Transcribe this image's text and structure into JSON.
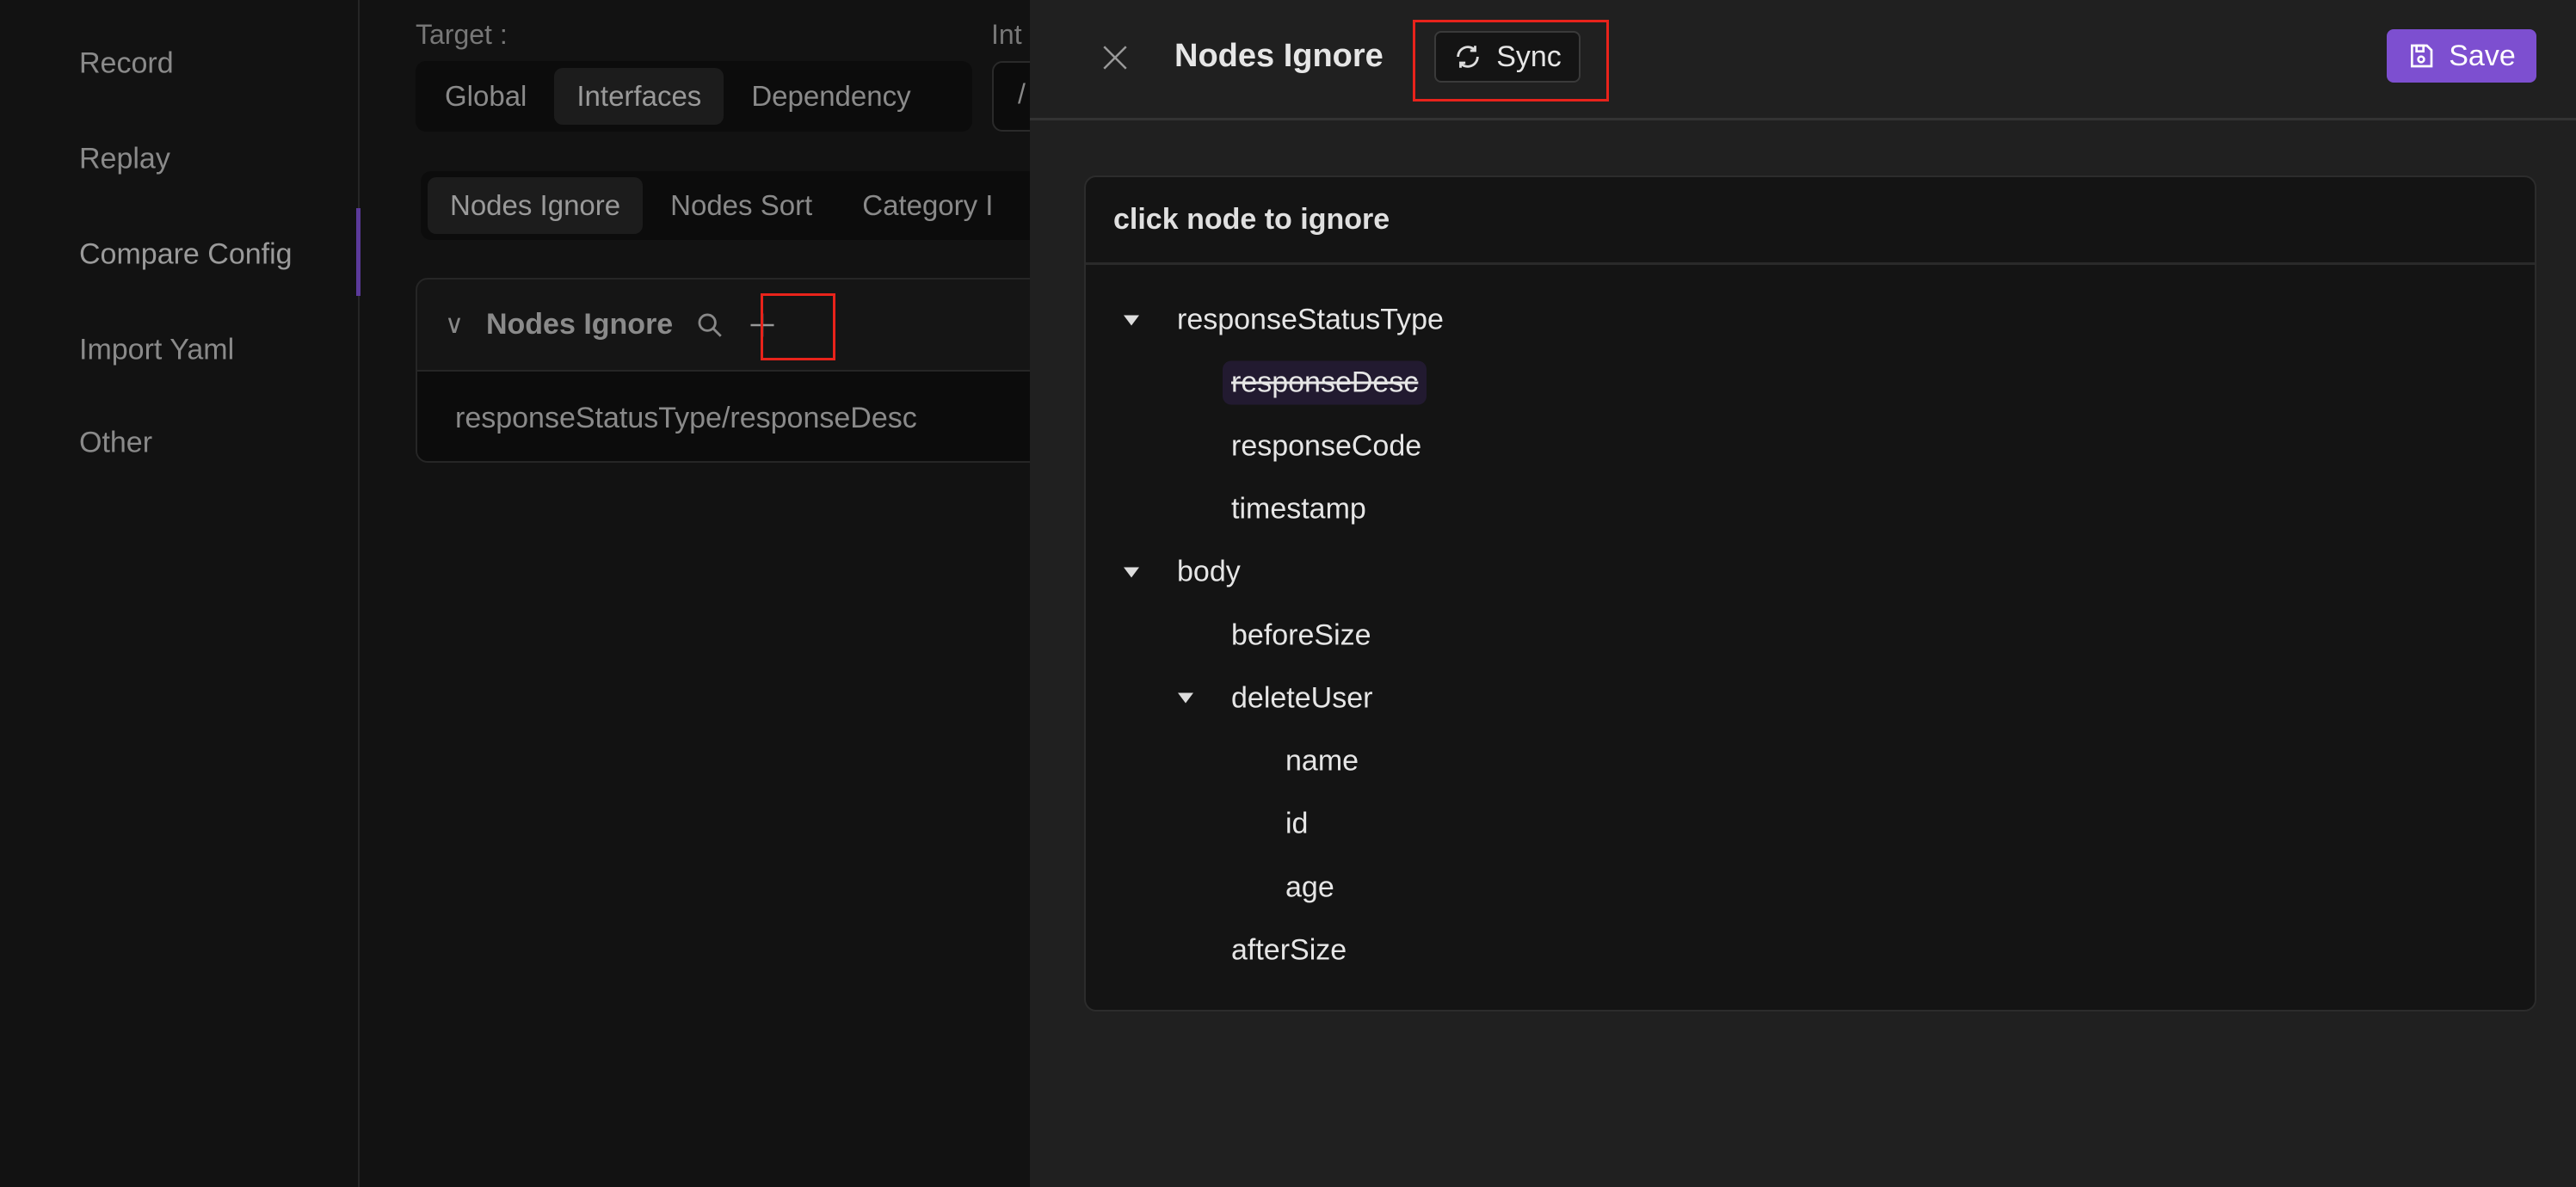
{
  "sidebar": {
    "items": [
      {
        "label": "Record"
      },
      {
        "label": "Replay"
      },
      {
        "label": "Compare Config",
        "active": true
      },
      {
        "label": "Import Yaml"
      },
      {
        "label": "Other"
      }
    ],
    "accent": "#5b3a9a"
  },
  "main": {
    "target_label": "Target :",
    "interface_label": "Int",
    "interface_value": "/",
    "target_options": [
      "Global",
      "Interfaces",
      "Dependency"
    ],
    "target_selected": "Interfaces",
    "tabs": [
      "Nodes Ignore",
      "Nodes Sort",
      "Category I"
    ],
    "tab_selected": "Nodes Ignore",
    "card": {
      "title": "Nodes Ignore",
      "rows": [
        "responseStatusType/responseDesc"
      ]
    }
  },
  "drawer": {
    "title": "Nodes Ignore",
    "sync_label": "Sync",
    "save_label": "Save",
    "save_color": "#7d4fd0",
    "tree_header": "click node to ignore",
    "tree": [
      {
        "label": "responseStatusType",
        "level": 0,
        "expanded": true
      },
      {
        "label": "responseDesc",
        "level": 1,
        "ignored": true
      },
      {
        "label": "responseCode",
        "level": 1
      },
      {
        "label": "timestamp",
        "level": 1
      },
      {
        "label": "body",
        "level": 0,
        "expanded": true
      },
      {
        "label": "beforeSize",
        "level": 1
      },
      {
        "label": "deleteUser",
        "level": 1,
        "expanded": true
      },
      {
        "label": "name",
        "level": 2
      },
      {
        "label": "id",
        "level": 2
      },
      {
        "label": "age",
        "level": 2
      },
      {
        "label": "afterSize",
        "level": 1
      }
    ]
  }
}
